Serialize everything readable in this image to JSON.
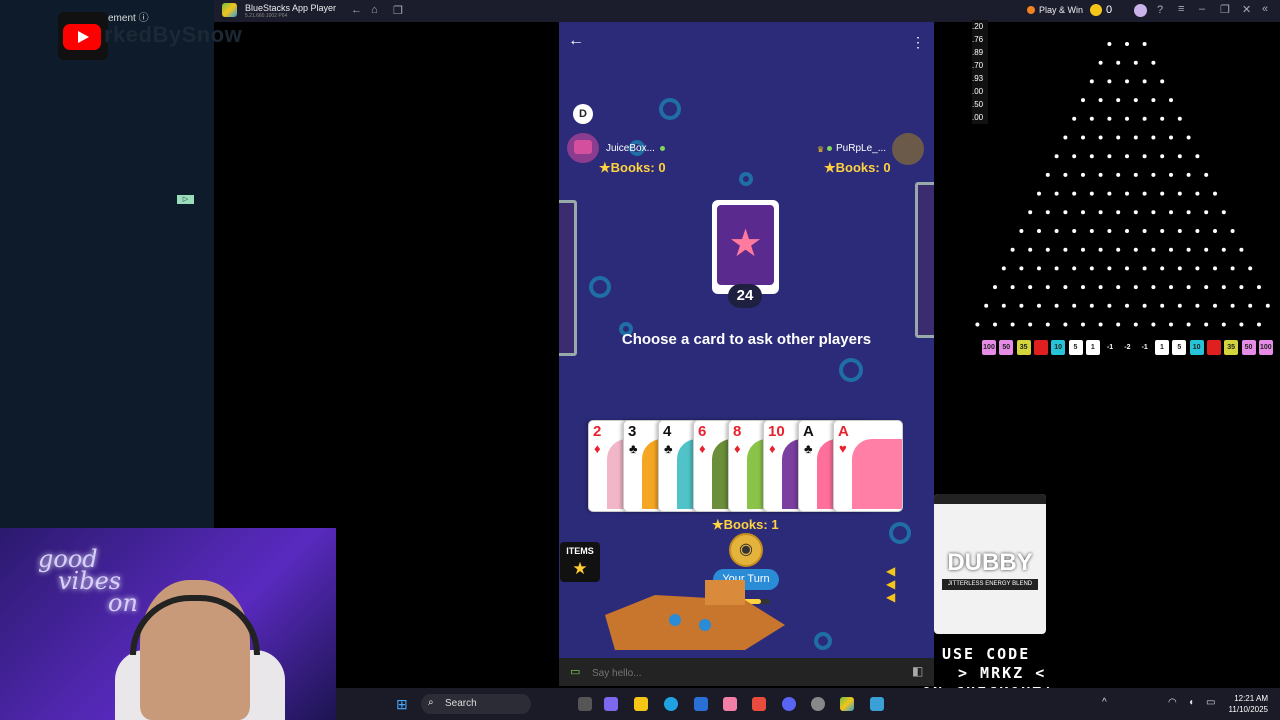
{
  "stream_overlay": {
    "watermark": "rkedBySnow",
    "ad_label": "ement ⓘ",
    "promo_line1": "USE CODE",
    "promo_line2": "> MRKZ <",
    "promo_line3": "ON CHECKOUT!",
    "product_brand": "DUBBY",
    "product_band": "JITTERLESS ENERGY BLEND",
    "webcam_sign_line1": "good",
    "webcam_sign_line2": "vibes",
    "webcam_sign_line3": "on"
  },
  "bluestacks": {
    "title": "BlueStacks App Player",
    "version": "5.21.660.1002 P64",
    "play_and_win": "Play & Win",
    "coin_count": "0"
  },
  "game": {
    "dealer_badge": "D",
    "opponent_left": {
      "name": "JuiceBox...",
      "books": "Books: 0"
    },
    "opponent_right": {
      "name": "PuRpLe_...",
      "books": "Books: 0"
    },
    "deck_count": "24",
    "prompt": "Choose a card to ask other players",
    "hand": [
      {
        "rank": "2",
        "suit": "♦",
        "color": "red",
        "art": "#f1b7c8"
      },
      {
        "rank": "3",
        "suit": "♣",
        "color": "black",
        "art": "#f5a623"
      },
      {
        "rank": "4",
        "suit": "♣",
        "color": "black",
        "art": "#4fc3c8"
      },
      {
        "rank": "6",
        "suit": "♦",
        "color": "red",
        "art": "#6b8e3a"
      },
      {
        "rank": "8",
        "suit": "♦",
        "color": "red",
        "art": "#8bc34a"
      },
      {
        "rank": "10",
        "suit": "♦",
        "color": "red",
        "art": "#7b3fa0"
      },
      {
        "rank": "A",
        "suit": "♣",
        "color": "black",
        "art": "#ff6f9c"
      },
      {
        "rank": "A",
        "suit": "♥",
        "color": "red",
        "art": "#ff7fa6"
      }
    ],
    "my_books": "Books: 1",
    "turn_label": "Your Turn",
    "timer_progress": 0.75,
    "items_label": "ITEMS",
    "chat_placeholder": "Say hello..."
  },
  "plinko": {
    "multipliers": [
      ".20",
      ".76",
      ".89",
      ".70",
      ".93",
      ".00",
      ".50",
      ".00"
    ],
    "slots": [
      {
        "label": "100",
        "color": "#e68ce6"
      },
      {
        "label": "50",
        "color": "#e68ce6"
      },
      {
        "label": "35",
        "color": "#d4d43c"
      },
      {
        "label": "",
        "color": "#e02020"
      },
      {
        "label": "10",
        "color": "#27c3d8"
      },
      {
        "label": "5",
        "color": "#ffffff"
      },
      {
        "label": "1",
        "color": "#ffffff"
      },
      {
        "label": "-1",
        "color": "#000000"
      },
      {
        "label": "-2",
        "color": "#000000"
      },
      {
        "label": "-1",
        "color": "#000000"
      },
      {
        "label": "1",
        "color": "#ffffff"
      },
      {
        "label": "5",
        "color": "#ffffff"
      },
      {
        "label": "10",
        "color": "#27c3d8"
      },
      {
        "label": "",
        "color": "#e02020"
      },
      {
        "label": "35",
        "color": "#d4d43c"
      },
      {
        "label": "50",
        "color": "#e68ce6"
      },
      {
        "label": "100",
        "color": "#e68ce6"
      }
    ]
  },
  "taskbar": {
    "search_label": "Search",
    "time": "12:21 AM",
    "date": "11/10/2025"
  }
}
